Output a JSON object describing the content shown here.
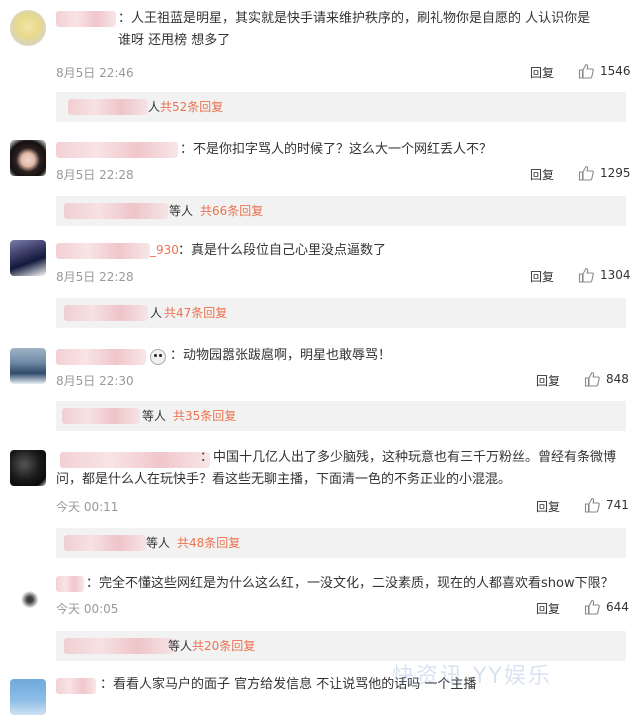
{
  "reply_label": "回复",
  "comments": [
    {
      "text": "：人王祖蓝是明星，其实就是快手请来维护秩序的，刷礼物你是自愿的  人认识你是谁呀  还甩榜  想多了",
      "time": "8月5日 22:46",
      "likes": "1546",
      "reply_suffix": "人",
      "reply_count": "共52条回复"
    },
    {
      "text": "：不是你扣字骂人的时候了？这么大一个网红丢人不？",
      "time": "8月5日 22:28",
      "likes": "1295",
      "reply_suffix": "等人",
      "reply_count": "共66条回复"
    },
    {
      "name_visible": "_930",
      "text": "：真是什么段位自己心里没点逼数了",
      "time": "8月5日 22:28",
      "likes": "1304",
      "reply_suffix": "人",
      "reply_count": "共47条回复"
    },
    {
      "text": "：动物园嚣张跋扈啊，明星也敢辱骂！",
      "time": "8月5日 22:30",
      "likes": "848",
      "reply_suffix": "等人",
      "reply_count": "共35条回复"
    },
    {
      "text": "：中国十几亿人出了多少脑残，这种玩意也有三千万粉丝。曾经有条微博问，都是什么人在玩快手？看这些无聊主播，下面清一色的不务正业的小混混。",
      "time": "今天 00:11",
      "likes": "741",
      "reply_suffix": "等人",
      "reply_count": "共48条回复"
    },
    {
      "text": "：完全不懂这些网红是为什么这么红，一没文化，二没素质，现在的人都喜欢看show下限？",
      "time": "今天 00:05",
      "likes": "644",
      "reply_suffix": "等人",
      "reply_count": "共20条回复"
    },
    {
      "text": "：看看人家马户的面子  官方给发信息  不让说骂他的话吗  一个主播"
    }
  ],
  "watermark": "快资讯 YY娱乐"
}
